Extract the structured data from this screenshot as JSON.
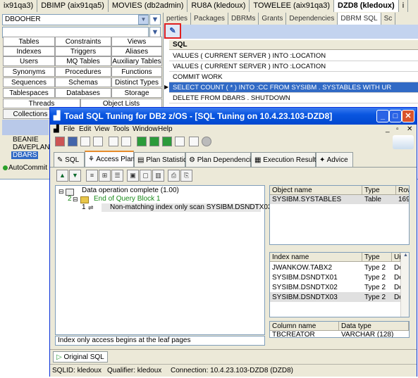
{
  "bg_window": {
    "tabs": [
      "ix91qa3)",
      "DBIMP (aix91qa5)",
      "MOVIES (db2admin)",
      "RU8A (kledoux)",
      "TOWELEE (aix91qa3)",
      "DZD8 (kledoux)",
      "i"
    ],
    "schema_combo": "DBOOHER",
    "object_types": [
      [
        "Tables",
        "Constraints",
        "Views"
      ],
      [
        "Indexes",
        "Triggers",
        "Aliases"
      ],
      [
        "Users",
        "MQ Tables",
        "Auxiliary Tables"
      ],
      [
        "Synonyms",
        "Procedures",
        "Functions"
      ],
      [
        "Sequences",
        "Schemas",
        "Distinct Types"
      ],
      [
        "Tablespaces",
        "Databases",
        "Storage Groups"
      ]
    ],
    "threads_label": "Threads",
    "object_lists_label": "Object Lists",
    "collections_label": "Collections",
    "tree_items": [
      "BEANIE",
      "DAVEPLAN",
      "DBARS"
    ],
    "autocommit_label": "AutoCommit",
    "right_tabs": [
      "perties",
      "Packages",
      "DBRMs",
      "Grants",
      "Dependencies",
      "DBRM SQL",
      "Sc"
    ],
    "sql_header": "SQL",
    "sql_rows": [
      "VALUES ( CURRENT SERVER ) INTO :LOCATION",
      "VALUES ( CURRENT SERVER ) INTO :LOCATION",
      "COMMIT WORK",
      "SELECT COUNT ( * ) INTO :CC FROM SYSIBM . SYSTABLES WITH UR",
      "DELETE FROM DBARS . SHUTDOWN"
    ]
  },
  "window": {
    "title": "Toad SQL Tuning for DB2 z/OS - [SQL Tuning on 10.4.23.103-DZD8]",
    "menu": [
      "File",
      "Edit",
      "View",
      "Tools",
      "Window",
      "Help"
    ],
    "tabs": [
      "SQL",
      "Access Plan",
      "Plan Statistics",
      "Plan Dependencies",
      "Execution Results",
      "Advice"
    ],
    "tree": [
      {
        "num": "",
        "label": "Data operation complete (1.00)"
      },
      {
        "num": "2",
        "label": "End of Query Block 1"
      },
      {
        "num": "1",
        "label": "Non-matching index only scan SYSIBM.DSNDTX03"
      }
    ],
    "description": "Index only access begins at the leaf pages",
    "object_grid": {
      "headers": [
        "Object name",
        "Type",
        "Row"
      ],
      "rows": [
        [
          "SYSIBM.SYSTABLES",
          "Table",
          "169"
        ]
      ]
    },
    "index_grid": {
      "headers": [
        "Index name",
        "Type",
        "Ur"
      ],
      "rows": [
        [
          "JWANKOW.TABX2",
          "Type 2",
          "De"
        ],
        [
          "SYSIBM.DSNDTX01",
          "Type 2",
          "De"
        ],
        [
          "SYSIBM.DSNDTX02",
          "Type 2",
          "De"
        ],
        [
          "SYSIBM.DSNDTX03",
          "Type 2",
          "De"
        ]
      ]
    },
    "column_grid": {
      "headers": [
        "Column name",
        "Data type"
      ],
      "rows": [
        [
          "TBCREATOR",
          "VARCHAR (128)"
        ]
      ]
    },
    "bottom_tab": "Original SQL",
    "status": {
      "sqlid": "SQLID: kledoux",
      "qualifier": "Qualifier: kledoux",
      "connection": "Connection: 10.4.23.103-DZD8 (DZD8)"
    }
  }
}
